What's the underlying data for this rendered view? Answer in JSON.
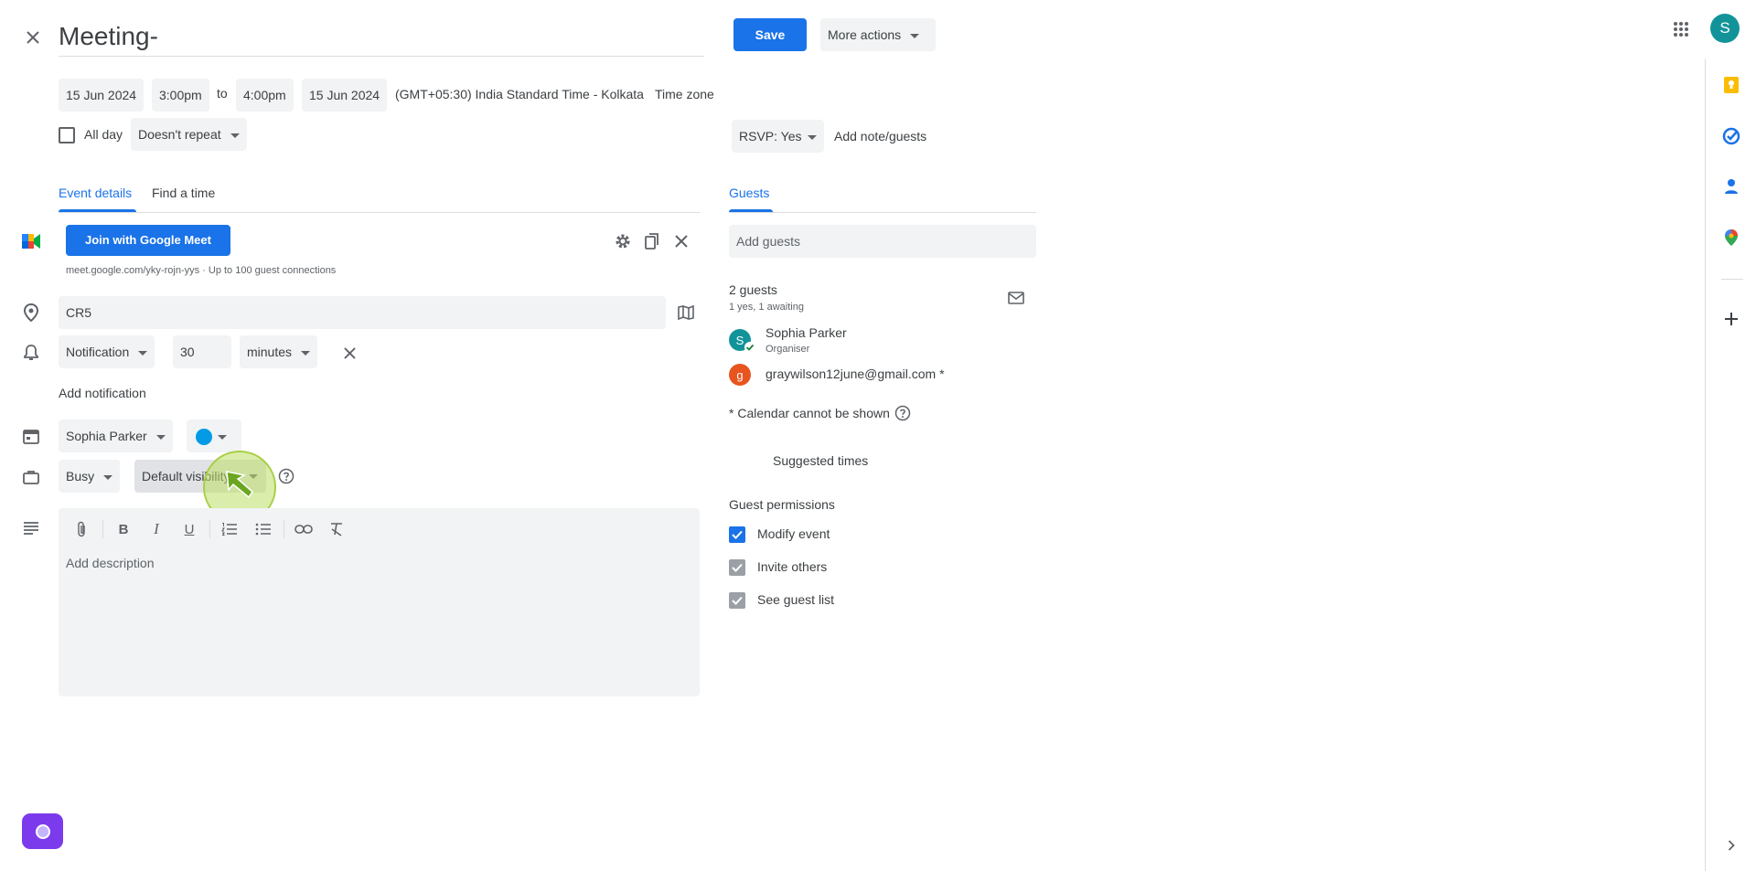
{
  "header": {
    "title": "Meeting-",
    "save_label": "Save",
    "more_actions_label": "More actions",
    "avatar_letter": "S"
  },
  "datetime": {
    "start_date": "15 Jun 2024",
    "start_time": "3:00pm",
    "to_label": "to",
    "end_time": "4:00pm",
    "end_date": "15 Jun 2024",
    "timezone": "(GMT+05:30) India Standard Time - Kolkata",
    "timezone_button": "Time zone",
    "all_day_label": "All day",
    "repeat": "Doesn't repeat"
  },
  "rsvp": {
    "value": "RSVP: Yes",
    "add_note_label": "Add note/guests"
  },
  "tabs": {
    "event_details": "Event details",
    "find_time": "Find a time",
    "guests": "Guests"
  },
  "meet": {
    "join_label": "Join with Google Meet",
    "link_text": "meet.google.com/yky-rojn-yys · Up to 100 guest connections"
  },
  "location": {
    "value": "CR5"
  },
  "notification": {
    "type": "Notification",
    "amount": "30",
    "unit": "minutes",
    "add_label": "Add notification"
  },
  "calendar": {
    "owner": "Sophia Parker",
    "color": "#039be5"
  },
  "availability": {
    "status": "Busy",
    "visibility": "Default visibility"
  },
  "description": {
    "placeholder": "Add description"
  },
  "guests": {
    "add_placeholder": "Add guests",
    "count_label": "2 guests",
    "summary": "1 yes, 1 awaiting",
    "list": [
      {
        "initial": "S",
        "name": "Sophia Parker",
        "role": "Organiser",
        "color": "#12939a"
      },
      {
        "initial": "g",
        "name": "graywilson12june@gmail.com *",
        "role": "",
        "color": "#e8541f"
      }
    ],
    "calendar_note": "* Calendar cannot be shown",
    "suggested_times": "Suggested times"
  },
  "permissions": {
    "title": "Guest permissions",
    "items": [
      {
        "label": "Modify event",
        "checked": true
      },
      {
        "label": "Invite others",
        "checked": true
      },
      {
        "label": "See guest list",
        "checked": true
      }
    ]
  },
  "colors": {
    "accent": "#1a73e8",
    "field_bg": "#f1f3f4",
    "pointer_highlight": "#c5e17a"
  }
}
